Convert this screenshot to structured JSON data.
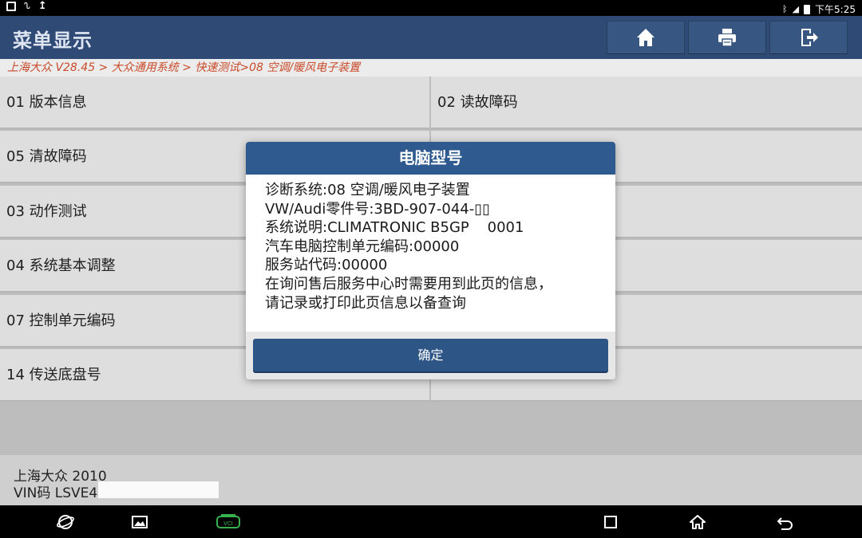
{
  "status_bar": {
    "time": "下午5:25",
    "icons": [
      "image-icon",
      "voicemail-icon",
      "upload-icon",
      "bluetooth-icon",
      "signal-icon",
      "battery-icon"
    ]
  },
  "header": {
    "title": "菜单显示",
    "buttons": [
      "home-icon",
      "printer-icon",
      "exit-icon"
    ]
  },
  "breadcrumb": "上海大众 V28.45 > 大众通用系统 > 快速测试>08 空调/暖风电子装置",
  "menu": {
    "left": [
      "01 版本信息",
      "05 清故障码",
      "03 动作测试",
      "04 系统基本调整",
      "07 控制单元编码",
      "14 传送底盘号"
    ],
    "right": [
      "02 读故障码",
      "",
      "",
      "",
      "",
      ""
    ]
  },
  "dialog": {
    "title": "电脑型号",
    "lines": [
      "诊断系统:08 空调/暖风电子装置",
      "VW/Audi零件号:3BD-907-044-▯▯",
      "系统说明:CLIMATRONIC B5GP    0001",
      "汽车电脑控制单元编码:00000",
      "服务站代码:00000",
      "在询问售后服务中心时需要用到此页的信息，",
      "请记录或打印此页信息以备查询"
    ],
    "ok_label": "确定"
  },
  "footer": {
    "line1": "上海大众  2010",
    "line2": "VIN码 LSVE4"
  },
  "nav_bar": {
    "icons": [
      "browser-icon",
      "gallery-icon",
      "vci-icon",
      "recent-apps-icon",
      "home-nav-icon",
      "back-icon"
    ],
    "vci_color": "#37b24d"
  },
  "colors": {
    "header_bg": "#2f4a74",
    "dialog_title_bg": "#2f5a8f",
    "breadcrumb_text": "#c94a2a"
  }
}
